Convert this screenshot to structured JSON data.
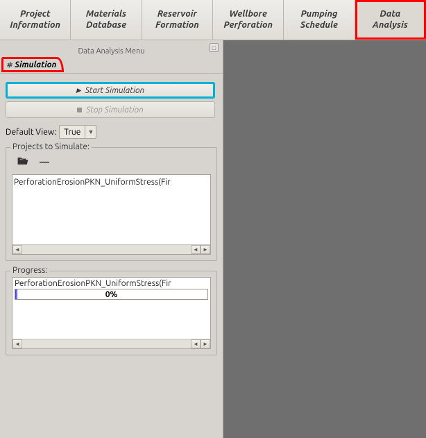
{
  "tabs": {
    "project_info": "Project\nInformation",
    "materials_db": "Materials\nDatabase",
    "reservoir": "Reservoir\nFormation",
    "wellbore": "Wellbore\nPerforation",
    "pumping": "Pumping\nSchedule",
    "data_analysis": "Data\nAnalysis"
  },
  "menu_title": "Data Analysis Menu",
  "simulation_tab": "Simulation",
  "buttons": {
    "start": "Start Simulation",
    "stop": "Stop Simulation"
  },
  "default_view_label": "Default View:",
  "default_view_value": "True",
  "projects_label": "Projects to Simulate:",
  "project_item": "PerforationErosionPKN_UniformStress(Fir",
  "progress_label": "Progress:",
  "progress_item": "PerforationErosionPKN_UniformStress(Fir",
  "progress_pct": "0%"
}
